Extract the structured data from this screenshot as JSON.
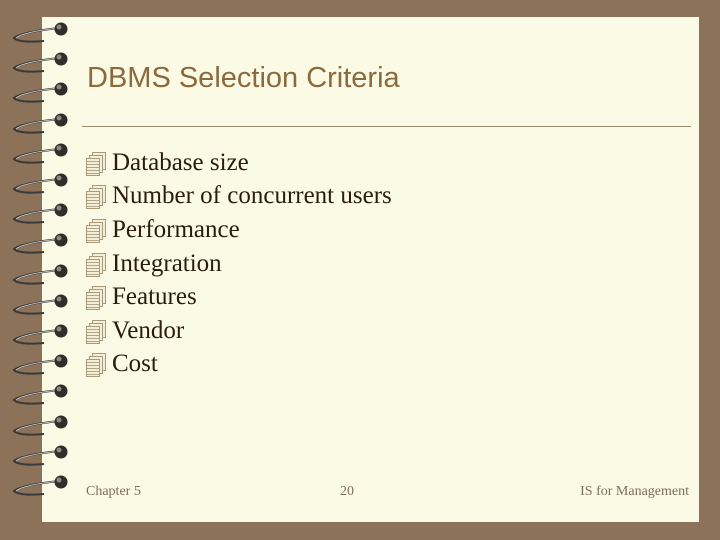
{
  "slide": {
    "title": "DBMS Selection Criteria",
    "bullet_icon": "stacked-pages-icon",
    "bullets": [
      "Database size",
      "Number of concurrent users",
      "Performance",
      "Integration",
      "Features",
      "Vendor",
      "Cost"
    ],
    "footer": {
      "left": "Chapter 5",
      "center": "20",
      "right": "IS for Management"
    }
  }
}
